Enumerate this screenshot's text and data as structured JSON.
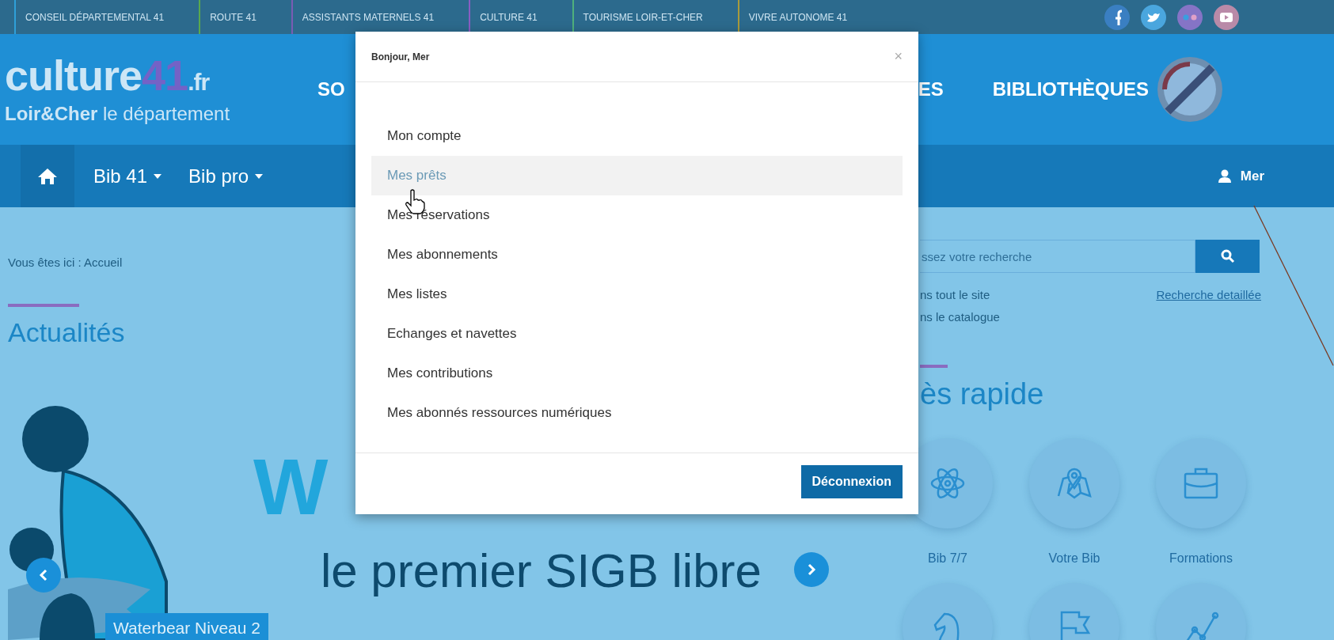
{
  "top_links": [
    {
      "label": "CONSEIL DÉPARTEMENTAL 41",
      "color": "#2f9fd8"
    },
    {
      "label": "ROUTE 41",
      "color": "#5aa84e"
    },
    {
      "label": "ASSISTANTS MATERNELS 41",
      "color": "#7a5cb3"
    },
    {
      "label": "CULTURE 41",
      "color": "#8a5dc2"
    },
    {
      "label": "TOURISME LOIR-ET-CHER",
      "color": "#4fb07c"
    },
    {
      "label": "VIVRE AUTONOME 41",
      "color": "#a89a3c"
    }
  ],
  "logo": {
    "name": "culture",
    "number": "41",
    "suffix": ".fr",
    "tagline": "**Loir&Cher** le département"
  },
  "header_nav": [
    {
      "label": "SO"
    },
    {
      "label": "ES"
    },
    {
      "label": "BIBLIOTHÈQUES"
    }
  ],
  "nav": {
    "items": [
      {
        "label": "Bib 41"
      },
      {
        "label": "Bib pro"
      }
    ],
    "user": "Mer"
  },
  "breadcrumb": "Vous êtes ici : Accueil",
  "news": {
    "title": "Actualités",
    "banner_letter": "W",
    "tagline": "le premier SIGB libre",
    "caption": "Waterbear Niveau 2"
  },
  "search": {
    "placeholder": "ssez votre recherche",
    "options": [
      "ns tout le site",
      "ns le catalogue"
    ],
    "advanced_link": "Recherche detaillée"
  },
  "quick_access": {
    "title": "ès rapide",
    "items": [
      {
        "kind": "labeled",
        "label": "Bib 7/7"
      },
      {
        "kind": "labeled",
        "label": "Votre Bib"
      },
      {
        "kind": "labeled",
        "label": "Formations"
      },
      {
        "kind": "icon_only"
      },
      {
        "kind": "icon_only"
      },
      {
        "kind": "icon_only"
      }
    ]
  },
  "modal": {
    "title": "Bonjour, Mer",
    "close": "×",
    "items": [
      {
        "label": "Mon compte",
        "selected": false
      },
      {
        "label": "Mes prêts",
        "selected": true
      },
      {
        "label": "Mes réservations",
        "selected": false
      },
      {
        "label": "Mes abonnements",
        "selected": false
      },
      {
        "label": "Mes listes",
        "selected": false
      },
      {
        "label": "Echanges et navettes",
        "selected": false
      },
      {
        "label": "Mes contributions",
        "selected": false
      },
      {
        "label": "Mes abonnés ressources numériques",
        "selected": false
      }
    ],
    "logout": "Déconnexion"
  }
}
